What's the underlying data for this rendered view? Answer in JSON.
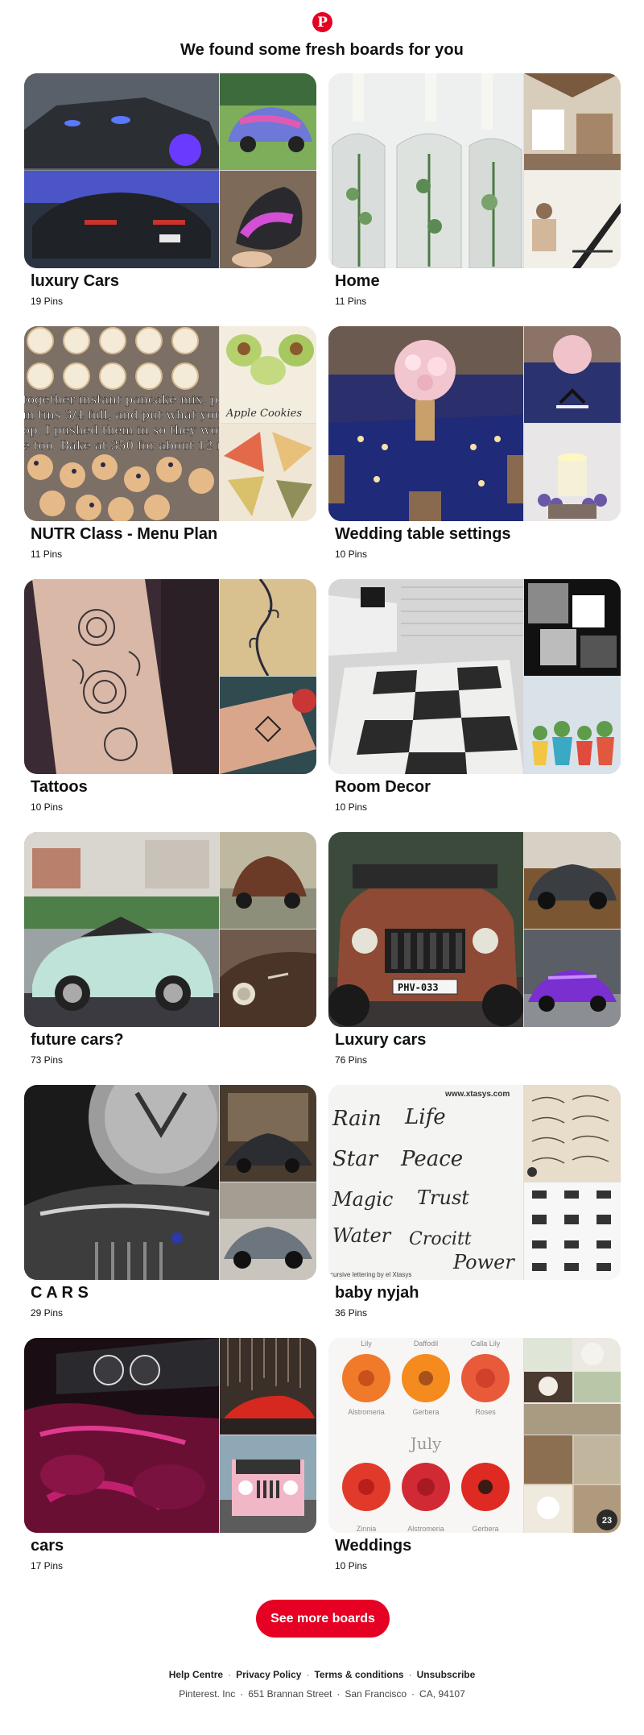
{
  "logo": {
    "letter": "P"
  },
  "headline": "We found some fresh boards for you",
  "boards": [
    {
      "title": "luxury Cars",
      "count": "19 Pins"
    },
    {
      "title": "Home",
      "count": "11 Pins"
    },
    {
      "title": "NUTR Class - Menu Plan",
      "count": "11 Pins"
    },
    {
      "title": "Wedding table settings",
      "count": "10 Pins"
    },
    {
      "title": "Tattoos",
      "count": "10 Pins"
    },
    {
      "title": "Room Decor",
      "count": "10 Pins"
    },
    {
      "title": "future cars?",
      "count": "73 Pins"
    },
    {
      "title": "Luxury cars",
      "count": "76 Pins"
    },
    {
      "title": "C A R S",
      "count": "29 Pins"
    },
    {
      "title": "baby nyjah",
      "count": "36 Pins"
    },
    {
      "title": "cars",
      "count": "17 Pins"
    },
    {
      "title": "Weddings",
      "count": "10 Pins"
    }
  ],
  "cta": {
    "label": "See more boards"
  },
  "footer": {
    "links": [
      "Help Centre",
      "Privacy Policy",
      "Terms & conditions",
      "Unsubscribe"
    ],
    "address": [
      "Pinterest. Inc",
      "651 Brannan Street",
      "San Francisco",
      "CA, 94107"
    ]
  },
  "image_text": {
    "pancake": [
      "together instant pancake mix, po",
      "in tins 3/4 full, and put what you",
      "op. I pushed them in so they wou",
      "e too. Bake at 350 for about 12 m"
    ],
    "apple_cookies": "Apple Cookies",
    "plate": "PHV-033",
    "xtasys": "www.xtasys.com",
    "lettering": [
      "Rain",
      "Life",
      "Star",
      "Peace",
      "Magic",
      "Trust",
      "Water",
      "Crocitt",
      "Power"
    ],
    "lettering_caption": "cursive lettering by el Xtasys",
    "flowers_top": [
      "Lily",
      "Daffodil",
      "Calla Lily"
    ],
    "flowers_mid": [
      "Alstromeria",
      "Gerbera",
      "Roses"
    ],
    "flowers_month": "July",
    "flowers_bottom": [
      "Zinnia",
      "Alstromeria",
      "Gerbera"
    ],
    "badge": "23"
  },
  "colors": {
    "brand": "#e60023"
  }
}
